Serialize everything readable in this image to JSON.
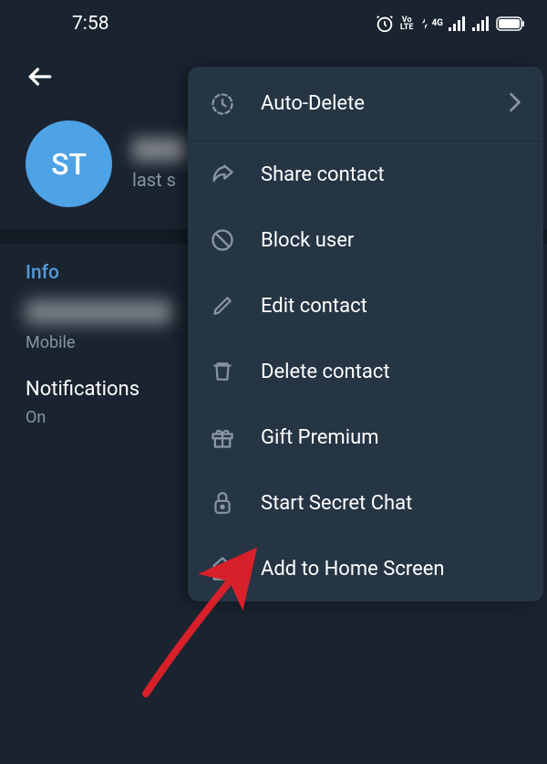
{
  "status": {
    "time": "7:58"
  },
  "profile": {
    "avatar_initials": "ST",
    "last_seen_prefix": "last s"
  },
  "info": {
    "section_label": "Info",
    "phone_type_label": "Mobile",
    "notifications_label": "Notifications",
    "notifications_value": "On"
  },
  "menu": {
    "auto_delete": "Auto-Delete",
    "share_contact": "Share contact",
    "block_user": "Block user",
    "edit_contact": "Edit contact",
    "delete_contact": "Delete contact",
    "gift_premium": "Gift Premium",
    "start_secret_chat": "Start Secret Chat",
    "add_home_screen": "Add to Home Screen"
  }
}
